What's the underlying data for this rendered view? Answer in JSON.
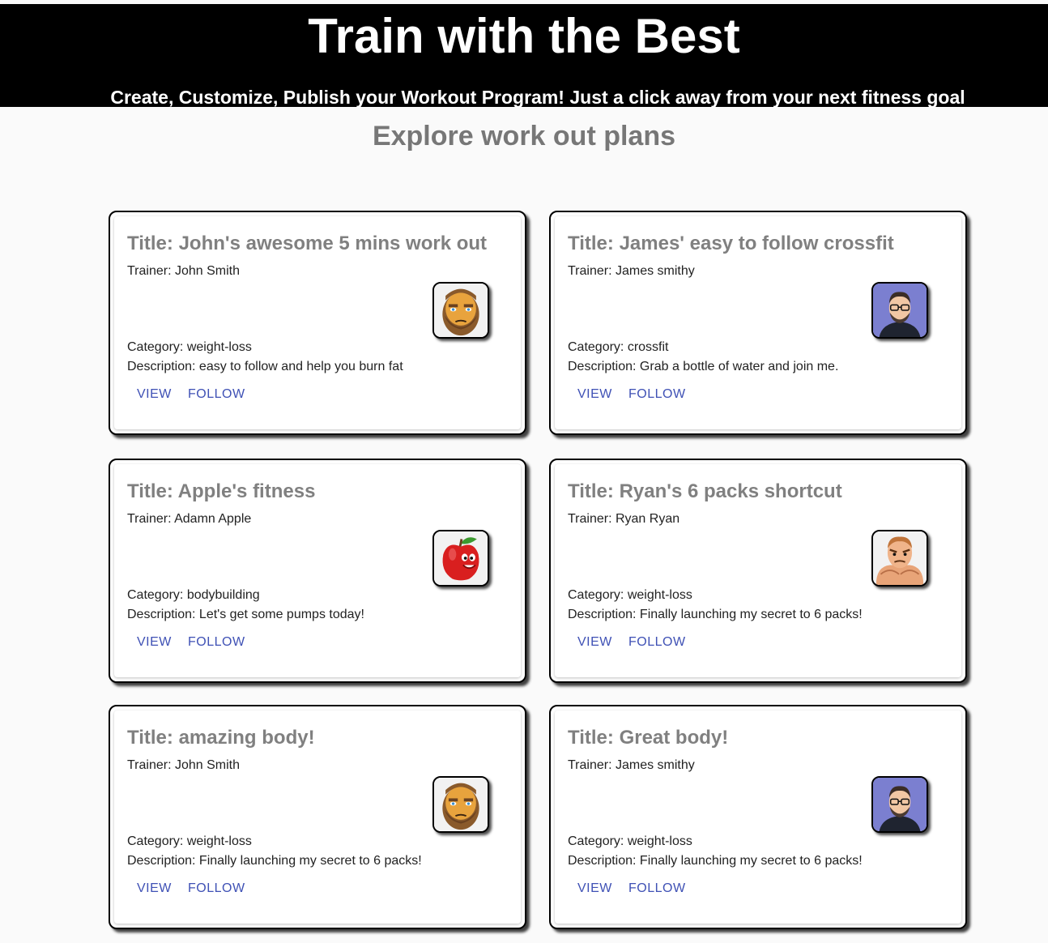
{
  "header": {
    "title": "Train with the Best",
    "subtitle": "Create, Customize, Publish your Workout Program! Just a click away from your next fitness goal"
  },
  "section": {
    "title": "Explore work out plans"
  },
  "plans": [
    {
      "title": "Title: John's awesome 5 mins work out",
      "trainer": "Trainer: John Smith",
      "category": "Category: weight-loss",
      "description": "Description: easy to follow and help you burn fat",
      "avatar_icon": "bearded-man-avatar-icon",
      "view_label": "VIEW",
      "follow_label": "FOLLOW"
    },
    {
      "title": "Title: James' easy to follow crossfit",
      "trainer": "Trainer: James smithy",
      "category": "Category: crossfit",
      "description": "Description: Grab a bottle of water and join me.",
      "avatar_icon": "man-with-glasses-avatar-icon",
      "view_label": "VIEW",
      "follow_label": "FOLLOW"
    },
    {
      "title": "Title: Apple's fitness",
      "trainer": "Trainer: Adamn Apple",
      "category": "Category: bodybuilding",
      "description": "Description: Let's get some pumps today!",
      "avatar_icon": "apple-character-avatar-icon",
      "view_label": "VIEW",
      "follow_label": "FOLLOW"
    },
    {
      "title": "Title: Ryan's 6 packs shortcut",
      "trainer": "Trainer: Ryan Ryan",
      "category": "Category: weight-loss",
      "description": "Description: Finally launching my secret to 6 packs!",
      "avatar_icon": "muscle-man-avatar-icon",
      "view_label": "VIEW",
      "follow_label": "FOLLOW"
    },
    {
      "title": "Title: amazing body!",
      "trainer": "Trainer: John Smith",
      "category": "Category: weight-loss",
      "description": "Description: Finally launching my secret to 6 packs!",
      "avatar_icon": "bearded-man-avatar-icon",
      "view_label": "VIEW",
      "follow_label": "FOLLOW"
    },
    {
      "title": "Title: Great body!",
      "trainer": "Trainer: James smithy",
      "category": "Category: weight-loss",
      "description": "Description: Finally launching my secret to 6 packs!",
      "avatar_icon": "man-with-glasses-avatar-icon",
      "view_label": "VIEW",
      "follow_label": "FOLLOW"
    }
  ],
  "colors": {
    "header_bg": "#000000",
    "header_text": "#ffffff",
    "title_gray": "#808080",
    "action_blue": "#3f51b5"
  }
}
